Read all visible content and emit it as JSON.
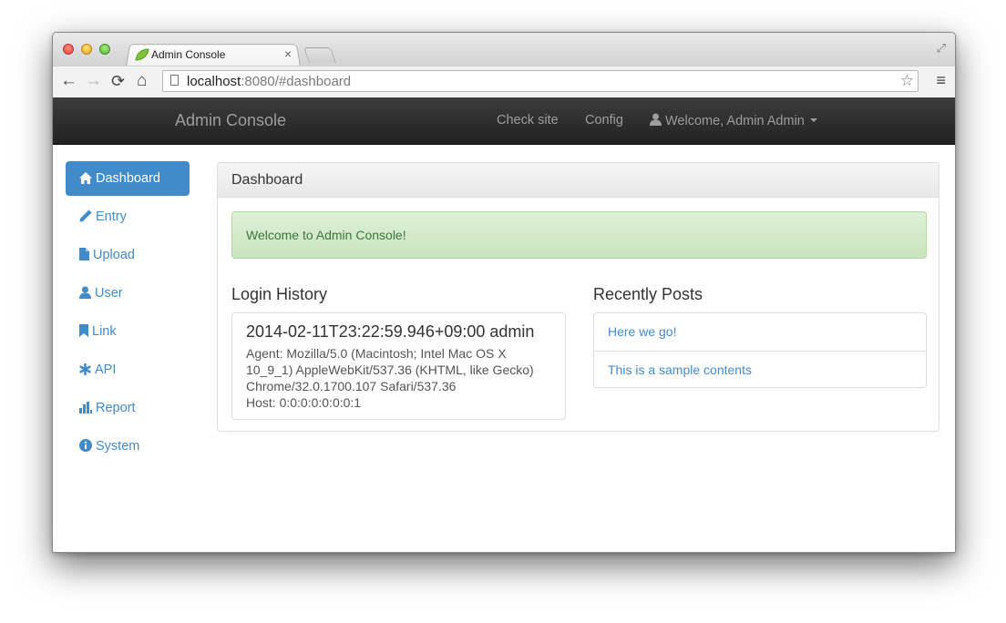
{
  "browser": {
    "tab_title": "Admin Console",
    "tab_close": "×",
    "url_host": "localhost",
    "url_rest": ":8080/#dashboard"
  },
  "navbar": {
    "brand": "Admin Console",
    "check_site": "Check site",
    "config": "Config",
    "user_menu": "Welcome, Admin Admin"
  },
  "sidebar": {
    "items": [
      {
        "label": "Dashboard",
        "icon": "home-icon",
        "active": true
      },
      {
        "label": "Entry",
        "icon": "pencil-icon"
      },
      {
        "label": "Upload",
        "icon": "file-icon"
      },
      {
        "label": "User",
        "icon": "user-icon"
      },
      {
        "label": "Link",
        "icon": "bookmark-icon"
      },
      {
        "label": "API",
        "icon": "asterisk-icon"
      },
      {
        "label": "Report",
        "icon": "stats-icon"
      },
      {
        "label": "System",
        "icon": "info-icon"
      }
    ]
  },
  "panel": {
    "title": "Dashboard",
    "alert": "Welcome to Admin Console!",
    "login_history": {
      "title": "Login History",
      "entries": [
        {
          "heading": "2014-02-11T23:22:59.946+09:00 admin",
          "lines": [
            "Agent: Mozilla/5.0 (Macintosh; Intel Mac OS X",
            "10_9_1) AppleWebKit/537.36 (KHTML, like Gecko)",
            "Chrome/32.0.1700.107 Safari/537.36",
            "Host: 0:0:0:0:0:0:0:1"
          ]
        }
      ]
    },
    "recent_posts": {
      "title": "Recently Posts",
      "items": [
        "Here we go!",
        "This is a sample contents"
      ]
    }
  },
  "colors": {
    "primary": "#428bca",
    "navbar": "#222222",
    "alert_bg": "#dff0d8",
    "alert_text": "#3c763d"
  }
}
